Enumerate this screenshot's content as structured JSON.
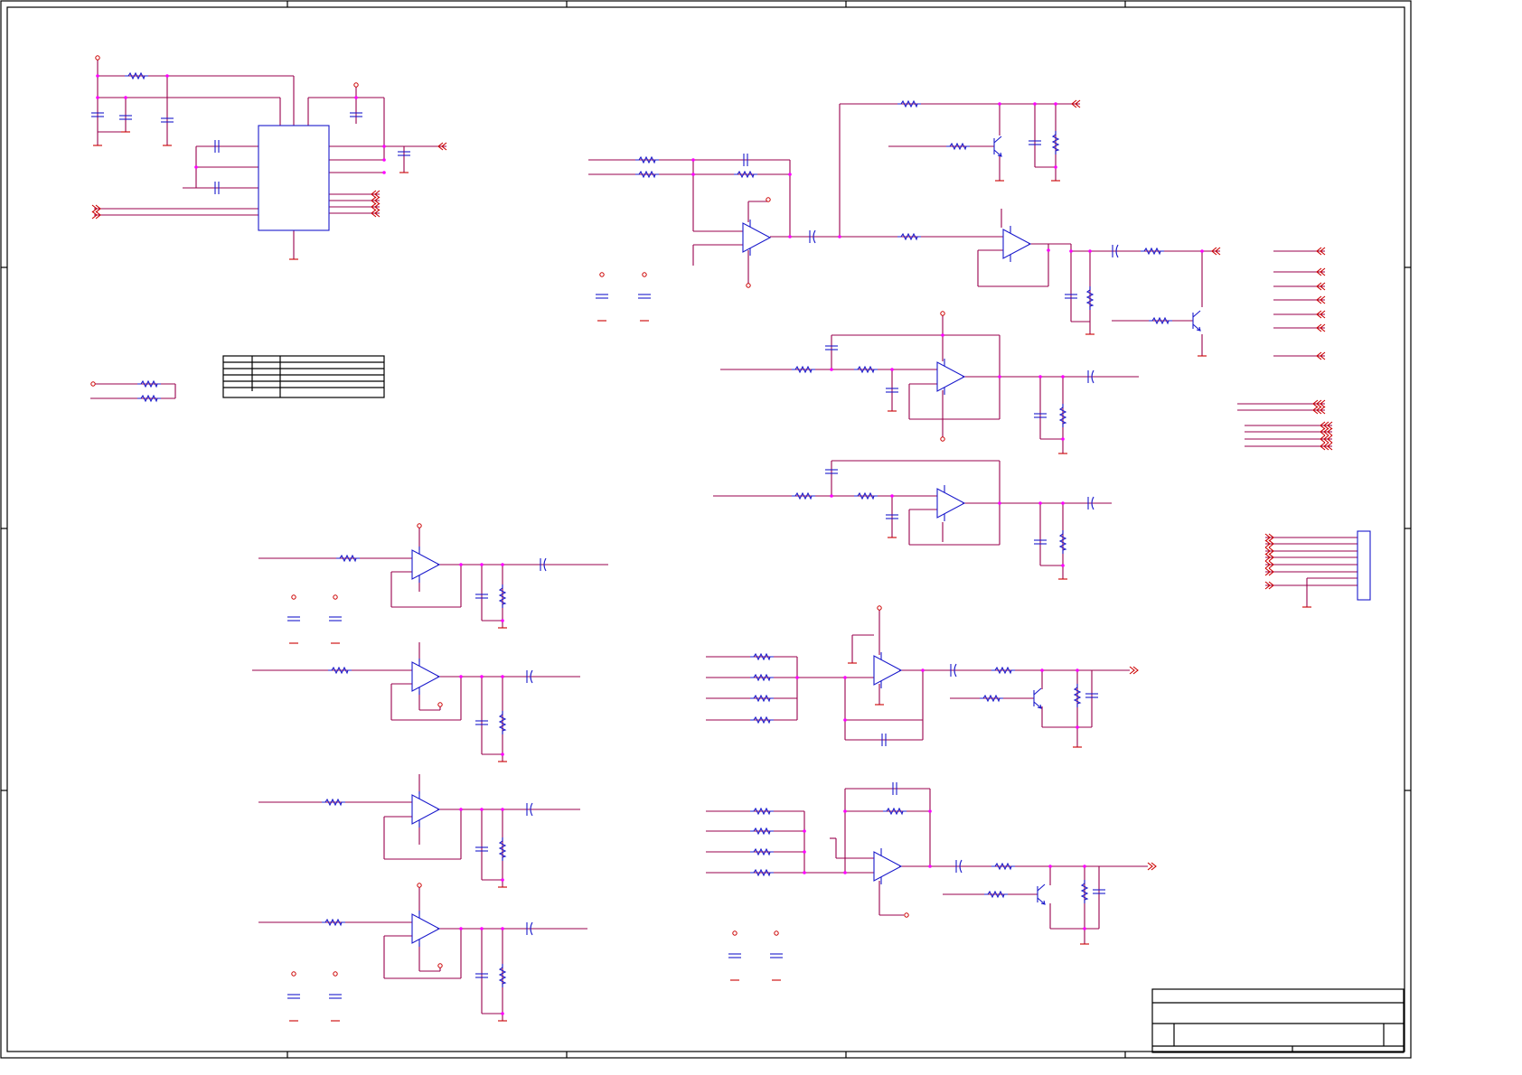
{
  "sheet": {
    "background": "#ffffff",
    "colors": {
      "wire": "#99004d",
      "pin": "#cc0000",
      "part": "#1a1acc",
      "junction": "#ff00ff",
      "frame": "#000000"
    }
  },
  "icons": {
    "resistor": "resistor-icon",
    "capacitor": "capacitor-icon",
    "opamp": "opamp-icon",
    "transistor": "npn-transistor-icon",
    "port": "port-arrow-icon",
    "power": "power-pin-icon",
    "ground": "ground-pin-icon"
  }
}
